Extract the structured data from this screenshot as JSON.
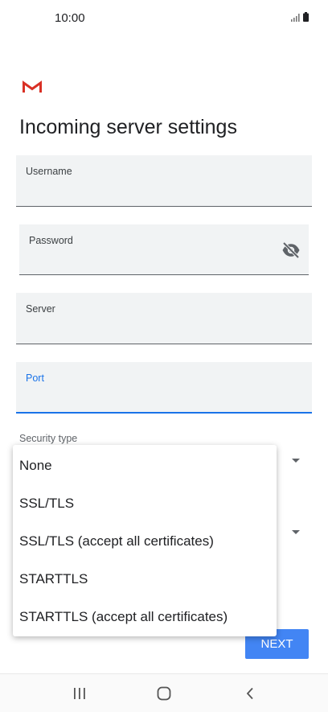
{
  "status_bar": {
    "time": "10:00"
  },
  "page": {
    "title": "Incoming server settings"
  },
  "fields": {
    "username": {
      "label": "Username",
      "value": ""
    },
    "password": {
      "label": "Password",
      "value": ""
    },
    "server": {
      "label": "Server",
      "value": ""
    },
    "port": {
      "label": "Port",
      "value": ""
    }
  },
  "security": {
    "label": "Security type"
  },
  "dropdown": {
    "options": [
      "None",
      "SSL/TLS",
      "SSL/TLS (accept all certificates)",
      "STARTTLS",
      "STARTTLS (accept all certificates)"
    ]
  },
  "actions": {
    "next_label": "NEXT"
  },
  "colors": {
    "accent": "#1a73e8",
    "button": "#4285f4",
    "gmail_red": "#d93025"
  },
  "icons": [
    "signal-icon",
    "battery-icon",
    "gmail-logo",
    "visibility-off-icon",
    "recent-apps-icon",
    "home-icon",
    "back-icon"
  ]
}
